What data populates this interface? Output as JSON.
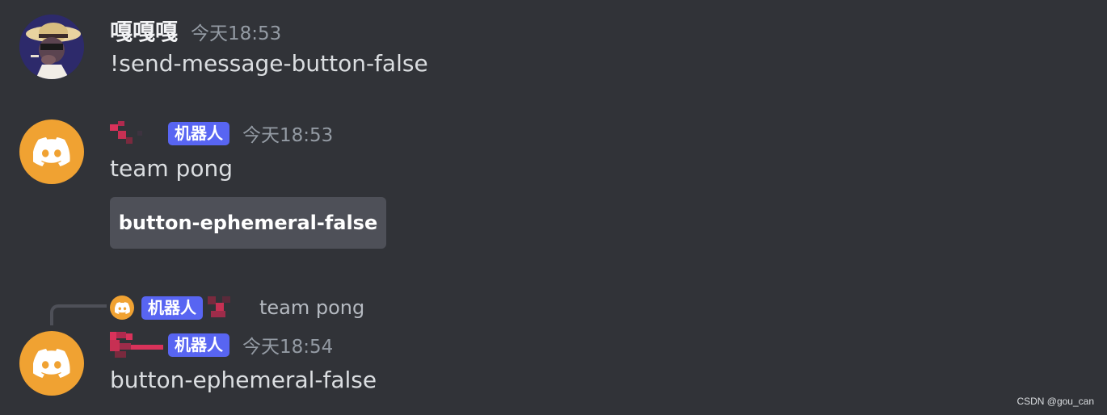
{
  "messages": [
    {
      "username": "嘎嘎嘎",
      "timestamp": "今天18:53",
      "content": "!send-message-button-false",
      "avatar_icon": "user-avatar-icon"
    },
    {
      "username": "",
      "badge": "机器人",
      "timestamp": "今天18:53",
      "content": "team pong",
      "button_label": "button-ephemeral-false",
      "avatar_icon": "discord-logo-icon"
    },
    {
      "reply": {
        "badge": "机器人",
        "content": "team pong"
      },
      "username": "",
      "badge": "机器人",
      "timestamp": "今天18:54",
      "content": "button-ephemeral-false",
      "avatar_icon": "discord-logo-icon"
    }
  ],
  "watermark": "CSDN @gou_can",
  "colors": {
    "background": "#313338",
    "discord_avatar": "#f0a232",
    "bot_badge": "#5865f2",
    "button": "#4e5058",
    "pixelated_name": "#d9325a"
  }
}
